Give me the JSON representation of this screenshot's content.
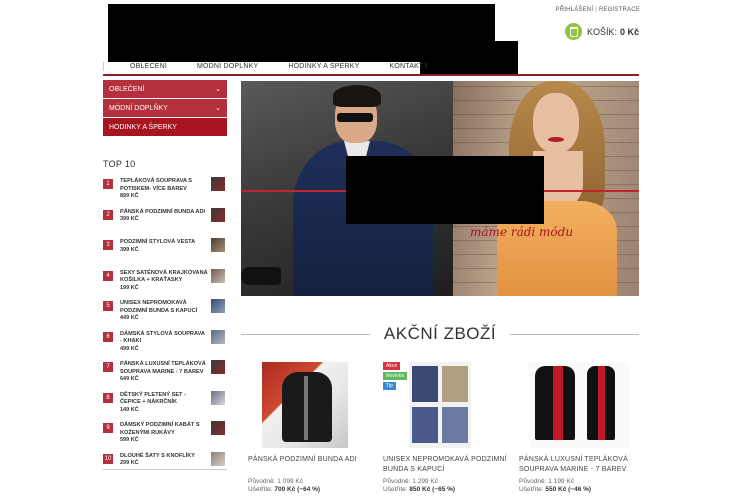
{
  "header": {
    "login": "PŘIHLÁŠENÍ",
    "separator": "|",
    "register": "REGISTRACE",
    "cart_label": "KOŠÍK:",
    "cart_value": "0 Kč",
    "cart_icon": "shopping-bag-icon",
    "accent_color": "#8dc63f"
  },
  "nav": {
    "items": [
      "OBLEČENÍ",
      "MÓDNÍ DOPLŇKY",
      "HODINKY A ŠPERKY",
      "KONTAKTY"
    ]
  },
  "sidebar": {
    "categories": [
      {
        "label": "OBLEČENÍ",
        "chevron": "⌄"
      },
      {
        "label": "MÓDNÍ DOPLŇKY",
        "chevron": "⌄"
      },
      {
        "label": "HODINKY A ŠPERKY",
        "chevron": ""
      }
    ],
    "top10_title": "TOP 10",
    "top10": [
      {
        "num": "1",
        "name": "TEPLÁKOVÁ SOUPRAVA S POTISKEM- VÍCE BAREV",
        "price": "899 Kč"
      },
      {
        "num": "2",
        "name": "PÁNSKÁ PODZIMNÍ BUNDA ADI",
        "price": "399 Kč"
      },
      {
        "num": "3",
        "name": "PODZIMNÍ STYLOVÁ VESTA",
        "price": "399 Kč"
      },
      {
        "num": "4",
        "name": "SEXY SATÉNOVÁ KRAJKOVANÁ KOŠILKA + KRAŤASKY",
        "price": "199 Kč"
      },
      {
        "num": "5",
        "name": "UNISEX NEPROMOKAVÁ PODZIMNÍ BUNDA S KAPUCÍ",
        "price": "449 Kč"
      },
      {
        "num": "6",
        "name": "DÁMSKÁ STYLOVÁ SOUPRAVA - KHAKI",
        "price": "499 Kč"
      },
      {
        "num": "7",
        "name": "PÁNSKÁ LUXUSNÍ TEPLÁKOVÁ SOUPRAVA MARINE - 7 BAREV",
        "price": "649 Kč"
      },
      {
        "num": "8",
        "name": "DĚTSKÝ PLETENÝ SET - ČEPICE + NÁKRČNÍK",
        "price": "149 Kč"
      },
      {
        "num": "9",
        "name": "DÁMSKÝ PODZIMNÍ KABÁT S KOŽENÝMI RUKÁVY",
        "price": "599 Kč"
      },
      {
        "num": "10",
        "name": "DLOUHÉ ŠATY S KNOFLÍKY",
        "price": "299 Kč"
      }
    ]
  },
  "banner": {
    "slogan": "máme rádi módu"
  },
  "section": {
    "title": "AKČNÍ ZBOŽÍ"
  },
  "products": [
    {
      "name": "PÁNSKÁ PODZIMNÍ BUNDA ADI",
      "orig_label": "Původně:",
      "orig_price": "1 099 Kč",
      "save_label": "Ušetříte:",
      "save_value": "700 Kč (−64 %)"
    },
    {
      "name": "UNISEX NEPROMOKAVÁ PODZIMNÍ BUNDA S KAPUCÍ",
      "orig_label": "Původně:",
      "orig_price": "1 299 Kč",
      "save_label": "Ušetříte:",
      "save_value": "850 Kč (−65 %)",
      "badges": [
        {
          "label": "Akce",
          "color": "#d9343f"
        },
        {
          "label": "Novinka",
          "color": "#5cb85c"
        },
        {
          "label": "Tip",
          "color": "#3a8ad6"
        }
      ]
    },
    {
      "name": "PÁNSKÁ LUXUSNÍ TEPLÁKOVÁ SOUPRAVA MARINE - 7 BAREV",
      "orig_label": "Původně:",
      "orig_price": "1 199 Kč",
      "save_label": "Ušetříte:",
      "save_value": "550 Kč (−46 %)"
    }
  ]
}
